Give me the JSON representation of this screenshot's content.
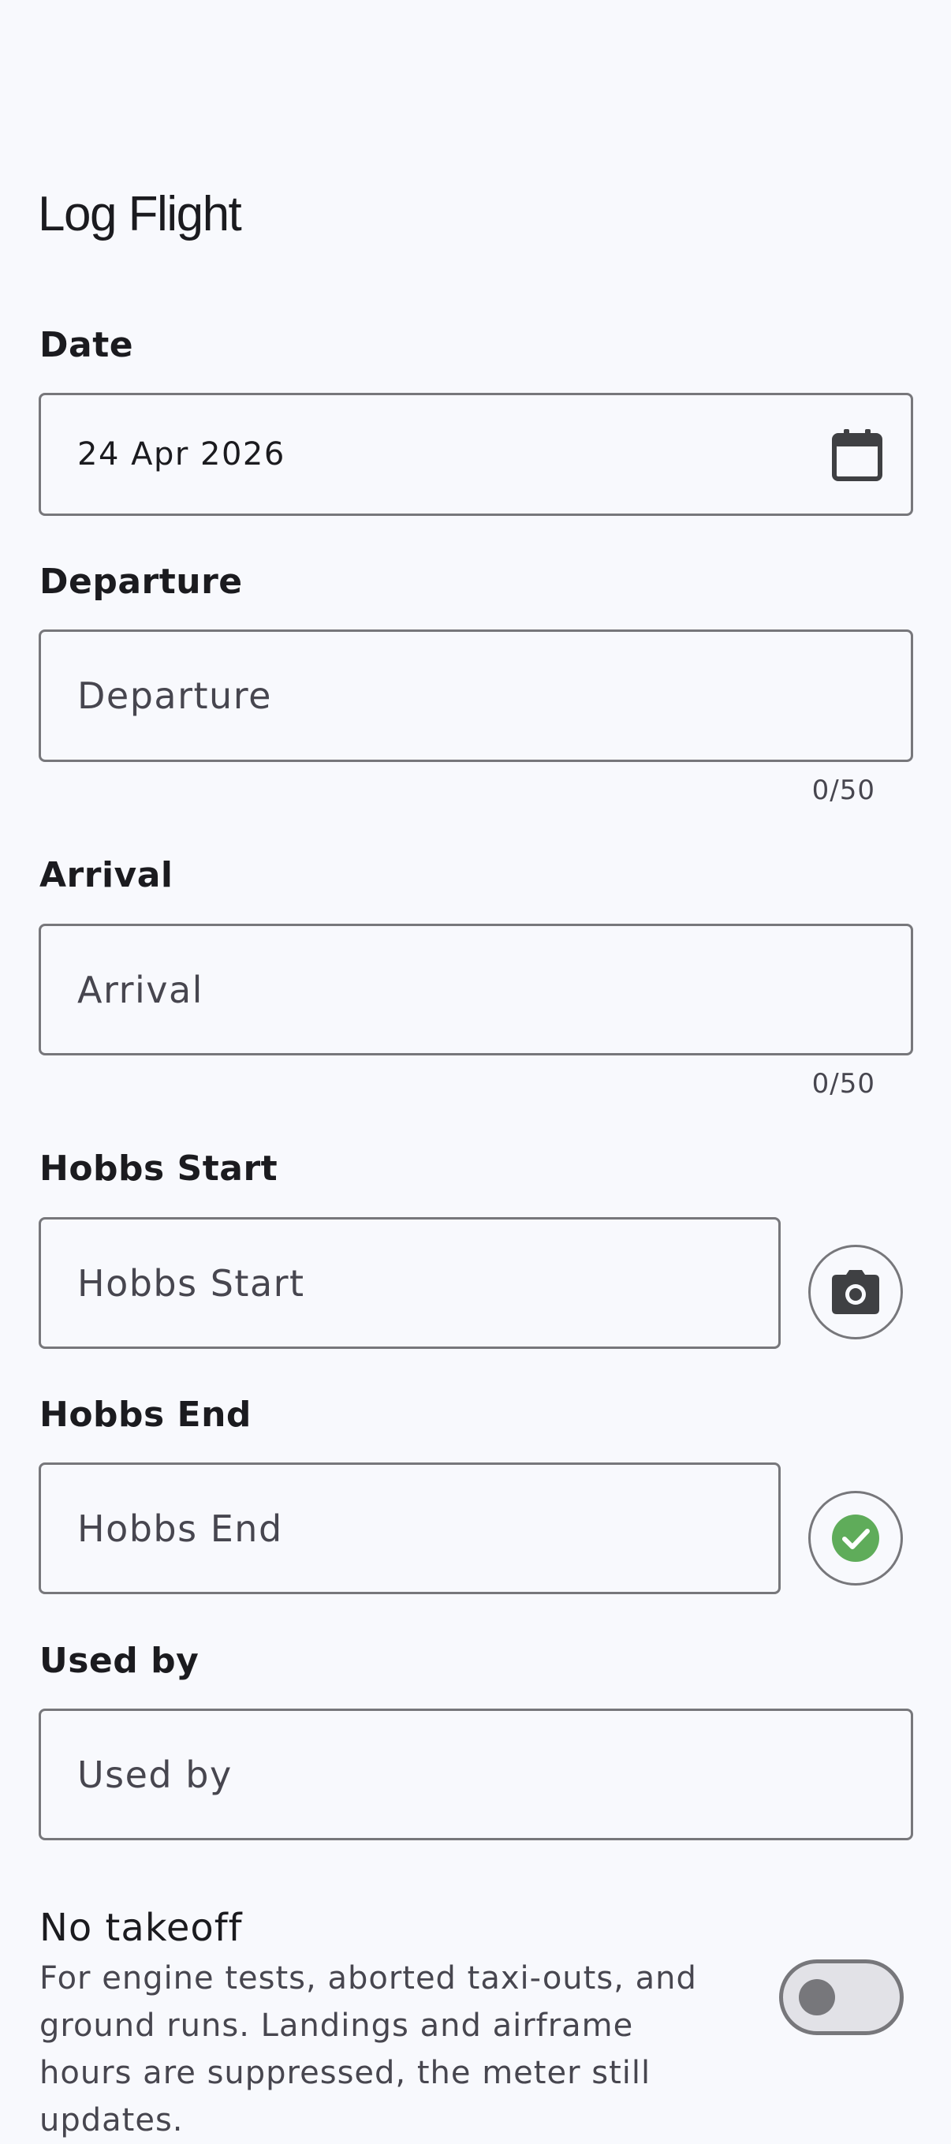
{
  "header": {
    "title": "Log Flight"
  },
  "form": {
    "date": {
      "label": "Date",
      "value": "24 Apr 2026",
      "icon": "calendar-icon"
    },
    "departure": {
      "label": "Departure",
      "placeholder": "Departure",
      "counter": "0/50"
    },
    "arrival": {
      "label": "Arrival",
      "placeholder": "Arrival",
      "counter": "0/50"
    },
    "hobbs_start": {
      "label": "Hobbs Start",
      "placeholder": "Hobbs Start",
      "action_icon": "camera-icon"
    },
    "hobbs_end": {
      "label": "Hobbs End",
      "placeholder": "Hobbs End",
      "action_icon": "check-circle-icon"
    },
    "used_by": {
      "label": "Used by",
      "placeholder": "Used by"
    },
    "no_takeoff": {
      "title": "No takeoff",
      "description": "For engine tests, aborted taxi-outs, and ground runs. Landings and airframe hours are suppressed, the meter still updates.",
      "enabled": false
    }
  },
  "colors": {
    "background": "#f8f9fd",
    "outline": "#77777b",
    "text": "#1b1b1f",
    "muted_text": "#47464f",
    "success": "#5fac5a",
    "icon_dark": "#3f4043"
  }
}
